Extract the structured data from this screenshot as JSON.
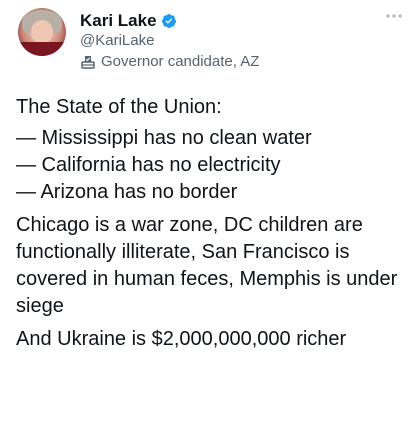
{
  "author": {
    "name": "Kari Lake",
    "handle": "@KariLake",
    "label": "Governor candidate, AZ"
  },
  "icons": {
    "verified": "verified-badge-icon",
    "ballot": "ballot-box-icon",
    "more": "more-options-icon"
  },
  "colors": {
    "verified": "#1d9bf0",
    "secondary_text": "#536471",
    "primary_text": "#0f1419"
  },
  "tweet": {
    "intro": "The State of the Union:",
    "list": [
      "— Mississippi has no clean water",
      "— California has no electricity",
      "— Arizona has no border"
    ],
    "paragraph_2": "Chicago is a war zone, DC children are functionally illiterate, San Francisco is covered in human feces, Memphis is under siege",
    "paragraph_3": "And Ukraine is $2,000,000,000 richer"
  }
}
